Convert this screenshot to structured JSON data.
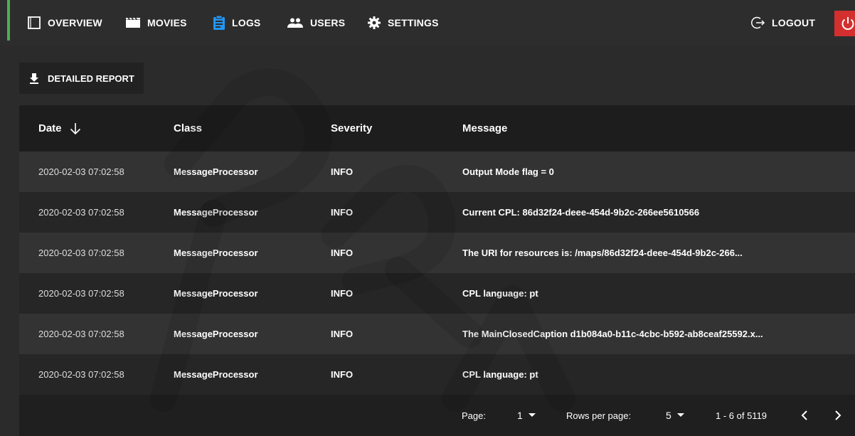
{
  "nav": {
    "items": [
      {
        "label": "OVERVIEW",
        "icon": "overview-icon"
      },
      {
        "label": "MOVIES",
        "icon": "movies-icon"
      },
      {
        "label": "LOGS",
        "icon": "logs-icon"
      },
      {
        "label": "USERS",
        "icon": "users-icon"
      },
      {
        "label": "SETTINGS",
        "icon": "settings-icon"
      }
    ],
    "logout_label": "LOGOUT",
    "accent_color": "#4caf50",
    "power_color": "#d32f2f"
  },
  "report_button": {
    "label": "DETAILED REPORT",
    "icon": "download-icon"
  },
  "table": {
    "columns": [
      "Date",
      "Class",
      "Severity",
      "Message"
    ],
    "sort_icon": "arrow-down-icon",
    "rows": [
      {
        "date": "2020-02-03 07:02:58",
        "class": "MessageProcessor",
        "severity": "INFO",
        "message": "Output Mode flag = 0"
      },
      {
        "date": "2020-02-03 07:02:58",
        "class": "MessageProcessor",
        "severity": "INFO",
        "message": "Current CPL: 86d32f24-deee-454d-9b2c-266ee5610566"
      },
      {
        "date": "2020-02-03 07:02:58",
        "class": "MessageProcessor",
        "severity": "INFO",
        "message": "The URI for resources is: /maps/86d32f24-deee-454d-9b2c-266..."
      },
      {
        "date": "2020-02-03 07:02:58",
        "class": "MessageProcessor",
        "severity": "INFO",
        "message": "CPL language: pt"
      },
      {
        "date": "2020-02-03 07:02:58",
        "class": "MessageProcessor",
        "severity": "INFO",
        "message": "The MainClosedCaption d1b084a0-b11c-4cbc-b592-ab8ceaf25592.x..."
      },
      {
        "date": "2020-02-03 07:02:58",
        "class": "MessageProcessor",
        "severity": "INFO",
        "message": "CPL language: pt"
      }
    ]
  },
  "pagination": {
    "page_label": "Page:",
    "page_value": "1",
    "rows_label": "Rows per page:",
    "rows_value": "5",
    "range": "1 - 6 of 5119"
  }
}
